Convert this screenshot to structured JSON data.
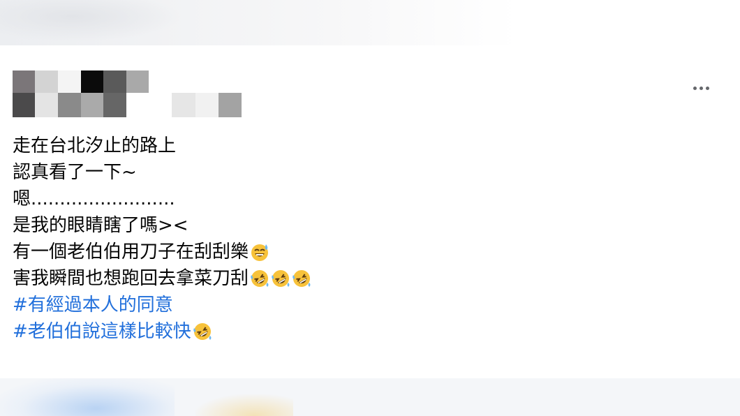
{
  "post": {
    "lines": [
      "走在台北汐止的路上",
      "認真看了一下~",
      "嗯.........................",
      "是我的眼睛瞎了嗎><",
      "有一個老伯伯用刀子在刮刮樂",
      "害我瞬間也想跑回去拿菜刀刮"
    ],
    "hashtags": [
      "#有經過本人的同意",
      "#老伯伯說這樣比較快"
    ],
    "emojis": {
      "line5": "sweat-smile-icon",
      "line6": "rofl-icon",
      "hashtag2": "rofl-icon"
    }
  },
  "colors": {
    "hashtag": "#216fdb",
    "text": "#050505",
    "more_dots": "#65676b"
  }
}
